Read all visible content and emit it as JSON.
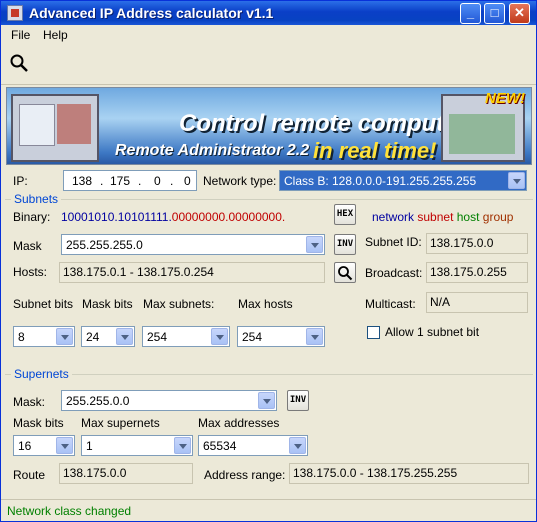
{
  "window": {
    "title": "Advanced IP Address calculator v1.1"
  },
  "menu": {
    "file": "File",
    "help": "Help"
  },
  "banner": {
    "line1": "Control remote computers",
    "line2": "Remote Administrator 2.2",
    "line3": "in real time!",
    "badge": "NEW!"
  },
  "ip": {
    "label": "IP:",
    "o1": "138",
    "o2": "175",
    "o3": "0",
    "o4": "0",
    "network_type_label": "Network type:",
    "network_type": "Class B: 128.0.0.0-191.255.255.255"
  },
  "subnets": {
    "title": "Subnets",
    "binary_label": "Binary:",
    "binary_network": "10001010.10101111.",
    "binary_host": "00000000.00000000.",
    "hex_label": "HEX",
    "legend": {
      "network": "network",
      "subnet": "subnet",
      "host": "host",
      "group": "group"
    },
    "mask_label": "Mask",
    "mask": "255.255.255.0",
    "inv_label": "INV",
    "subnet_id_label": "Subnet ID:",
    "subnet_id": "138.175.0.0",
    "hosts_label": "Hosts:",
    "hosts": "138.175.0.1 - 138.175.0.254",
    "broadcast_label": "Broadcast:",
    "broadcast": "138.175.0.255",
    "subnet_bits_label": "Subnet bits",
    "mask_bits_label": "Mask bits",
    "max_subnets_label": "Max subnets:",
    "max_hosts_label": "Max hosts",
    "multicast_label": "Multicast:",
    "multicast": "N/A",
    "subnet_bits": "8",
    "mask_bits": "24",
    "max_subnets": "254",
    "max_hosts": "254",
    "allow_label": "Allow 1 subnet bit"
  },
  "supernets": {
    "title": "Supernets",
    "mask_label": "Mask:",
    "mask": "255.255.0.0",
    "inv_label": "INV",
    "mask_bits_label": "Mask bits",
    "max_supernets_label": "Max supernets",
    "max_addresses_label": "Max addresses",
    "mask_bits": "16",
    "max_supernets": "1",
    "max_addresses": "65534",
    "route_label": "Route",
    "route": "138.175.0.0",
    "range_label": "Address range:",
    "range": "138.175.0.0 - 138.175.255.255"
  },
  "status": "Network class changed",
  "colors": {
    "network": "#0000a0",
    "subnet": "#c00000",
    "host": "#008000",
    "group": "#a03000"
  }
}
